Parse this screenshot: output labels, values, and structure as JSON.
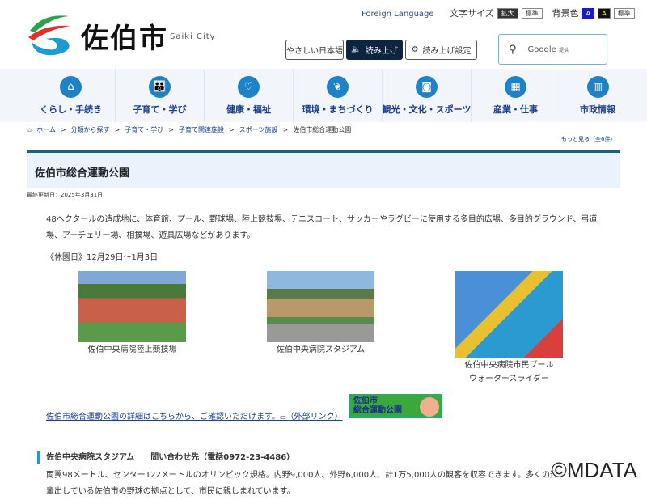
{
  "header": {
    "logo_text": "佐伯市",
    "logo_sub": "Saiki City",
    "foreign_language": "Foreign Language",
    "text_size_label": "文字サイズ",
    "text_size_enlarge": "拡大",
    "text_size_standard": "標準",
    "bg_color_label": "背景色",
    "bg_blue": "A",
    "bg_black": "A",
    "bg_standard": "標準",
    "easy_japanese": "やさしい日本語",
    "read_aloud": "読み上げ",
    "read_aloud_settings": "読み上げ設定",
    "search_placeholder": "Google",
    "search_provided": "提供"
  },
  "nav": [
    {
      "label": "くらし・手続き",
      "icon": "house-icon"
    },
    {
      "label": "子育て・学び",
      "icon": "family-icon"
    },
    {
      "label": "健康・福祉",
      "icon": "heart-hand-icon"
    },
    {
      "label": "環境・まちづくり",
      "icon": "leaf-icon"
    },
    {
      "label": "観光・文化・スポーツ",
      "icon": "camera-icon"
    },
    {
      "label": "産業・仕事",
      "icon": "factory-icon"
    },
    {
      "label": "市政情報",
      "icon": "building-icon"
    }
  ],
  "breadcrumb": [
    "ホーム",
    "分類から探す",
    "子育て・学び",
    "子育て関連施設",
    "スポーツ施設",
    "佐伯市総合運動公園"
  ],
  "more_link": "もっと見る（全6件）",
  "page_title": "佐伯市総合運動公園",
  "last_updated": "最終更新日：2025年3月31日",
  "intro": "48ヘクタールの造成地に、体育館、プール、野球場、陸上競技場、テニスコート、サッカーやラグビーに使用する多目的広場、多目的グラウンド、弓道場、アーチェリー場、相撲場、遊具広場などがあります。",
  "closed": "《休園日》12月29日～1月3日",
  "photos": [
    {
      "caption": "佐伯中央病院陸上競技場"
    },
    {
      "caption": "佐伯中央病院スタジアム"
    },
    {
      "caption": "佐伯中央病院市民プール",
      "caption2": "ウォータースライダー"
    }
  ],
  "external_link": "佐伯市総合運動公園の詳細はこちらから、ご確認いただけます。",
  "external_suffix": "（外部リンク）",
  "banner_line1": "佐伯市",
  "banner_line2": "総合運動公園",
  "section_heading": "佐伯中央病院スタジアム　　問い合わせ先（電話0972-23-4486）",
  "section_text": "両翼98メートル、センター122メートルのオリンピック規格。内野9,000人、外野6,000人、計1万5,000人の観客を収容できます。多くの選手を",
  "section_text2": "輩出している佐伯市の野球の拠点として、市民に親しまれています。",
  "watermark": "©MDATA"
}
